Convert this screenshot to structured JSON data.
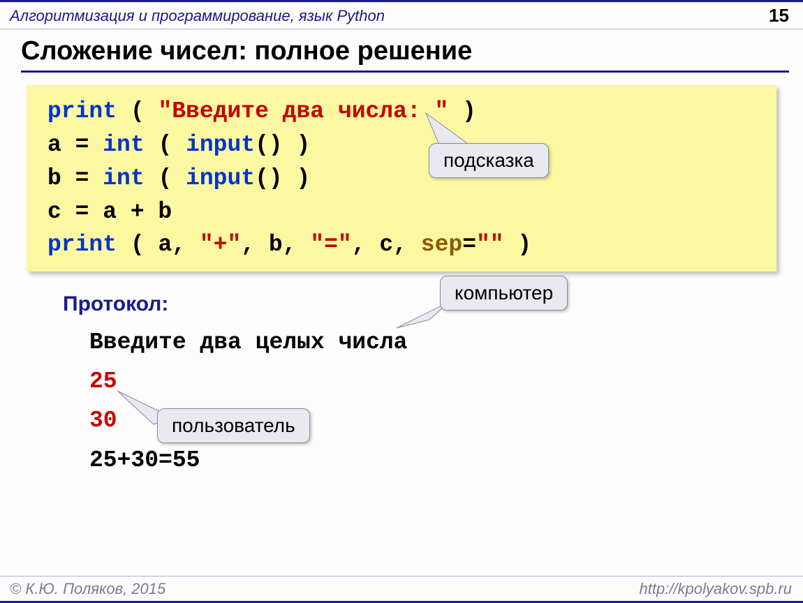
{
  "header": {
    "course_title": "Алгоритмизация и программирование, язык Python",
    "page_number": "15"
  },
  "title": "Сложение чисел: полное решение",
  "code": {
    "line1": {
      "kw": "print",
      "open": " ( ",
      "str": "\"Введите два числа: \"",
      "close": " )"
    },
    "line2": {
      "pre": "a = ",
      "kw": "int",
      "open": " ( ",
      "fn": "input",
      "post": "() )"
    },
    "line3": {
      "pre": "b = ",
      "kw": "int",
      "open": " ( ",
      "fn": "input",
      "post": "() )"
    },
    "line4": "c = a + b",
    "line5": {
      "kw": "print",
      "open": " ( a, ",
      "s1": "\"+\"",
      "mid1": ", b, ",
      "s2": "\"=\"",
      "mid2": ", c, ",
      "sep": "sep",
      "eq": "=",
      "s3": "\"\"",
      "close": " )"
    }
  },
  "callouts": {
    "hint": "подсказка",
    "computer": "компьютер",
    "user": "пользователь"
  },
  "protocol": {
    "label": "Протокол:",
    "prompt": "Введите два целых числа",
    "input1": "25",
    "input2": "30",
    "result": "25+30=55"
  },
  "footer": {
    "copyright": "© К.Ю. Поляков, 2015",
    "url": "http://kpolyakov.spb.ru"
  }
}
